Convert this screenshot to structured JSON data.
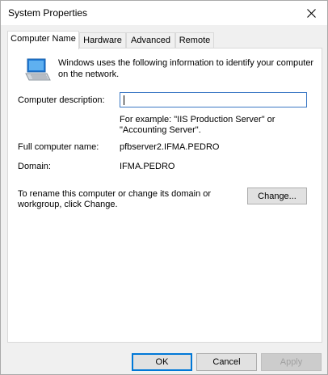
{
  "window": {
    "title": "System Properties"
  },
  "tabs": [
    {
      "label": "Computer Name"
    },
    {
      "label": "Hardware"
    },
    {
      "label": "Advanced"
    },
    {
      "label": "Remote"
    }
  ],
  "intro": {
    "line1": "Windows uses the following information to identify your computer",
    "line2": "on the network."
  },
  "form": {
    "description_label": "Computer description:",
    "description_value": "",
    "example_line1": "For example: \"IIS Production Server\" or",
    "example_line2": "\"Accounting Server\".",
    "full_name_label": "Full computer name:",
    "full_name_value": "pfbserver2.IFMA.PEDRO",
    "domain_label": "Domain:",
    "domain_value": "IFMA.PEDRO"
  },
  "rename": {
    "line1": "To rename this computer or change its domain or",
    "line2": "workgroup, click Change.",
    "button": "Change..."
  },
  "footer": {
    "ok": "OK",
    "cancel": "Cancel",
    "apply": "Apply"
  },
  "icons": {
    "close": "close-icon",
    "computer": "computer-icon"
  }
}
